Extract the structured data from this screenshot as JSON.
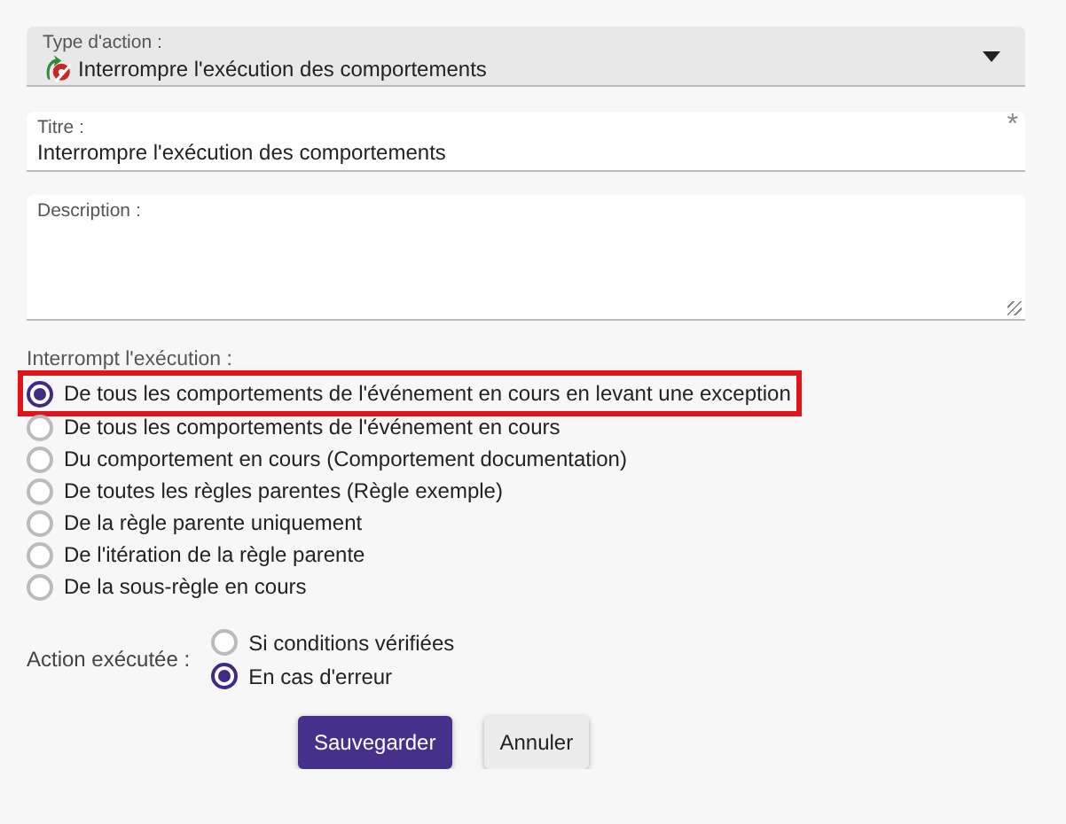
{
  "action_type": {
    "label": "Type d'action :",
    "value": "Interrompre l'exécution des comportements"
  },
  "title_field": {
    "label": "Titre :",
    "value": "Interrompre l'exécution des comportements",
    "required_mark": "*"
  },
  "description_field": {
    "label": "Description :"
  },
  "interrupt": {
    "label": "Interrompt l'exécution :",
    "options": [
      {
        "label": "De tous les comportements de l'événement en cours en levant une exception",
        "selected": true,
        "highlighted": true
      },
      {
        "label": "De tous les comportements de l'événement en cours",
        "selected": false,
        "highlighted": false
      },
      {
        "label": "Du comportement en cours (Comportement documentation)",
        "selected": false,
        "highlighted": false
      },
      {
        "label": "De toutes les règles parentes (Règle exemple)",
        "selected": false,
        "highlighted": false
      },
      {
        "label": "De la règle parente uniquement",
        "selected": false,
        "highlighted": false
      },
      {
        "label": "De l'itération de la règle parente",
        "selected": false,
        "highlighted": false
      },
      {
        "label": "De la sous-règle en cours",
        "selected": false,
        "highlighted": false
      }
    ]
  },
  "action_executed": {
    "label": "Action exécutée :",
    "options": [
      {
        "label": "Si conditions vérifiées",
        "selected": false
      },
      {
        "label": "En cas d'erreur",
        "selected": true
      }
    ]
  },
  "buttons": [
    {
      "label": "Sauvegarder",
      "kind": "primary"
    },
    {
      "label": "Annuler",
      "kind": "secondary"
    }
  ]
}
